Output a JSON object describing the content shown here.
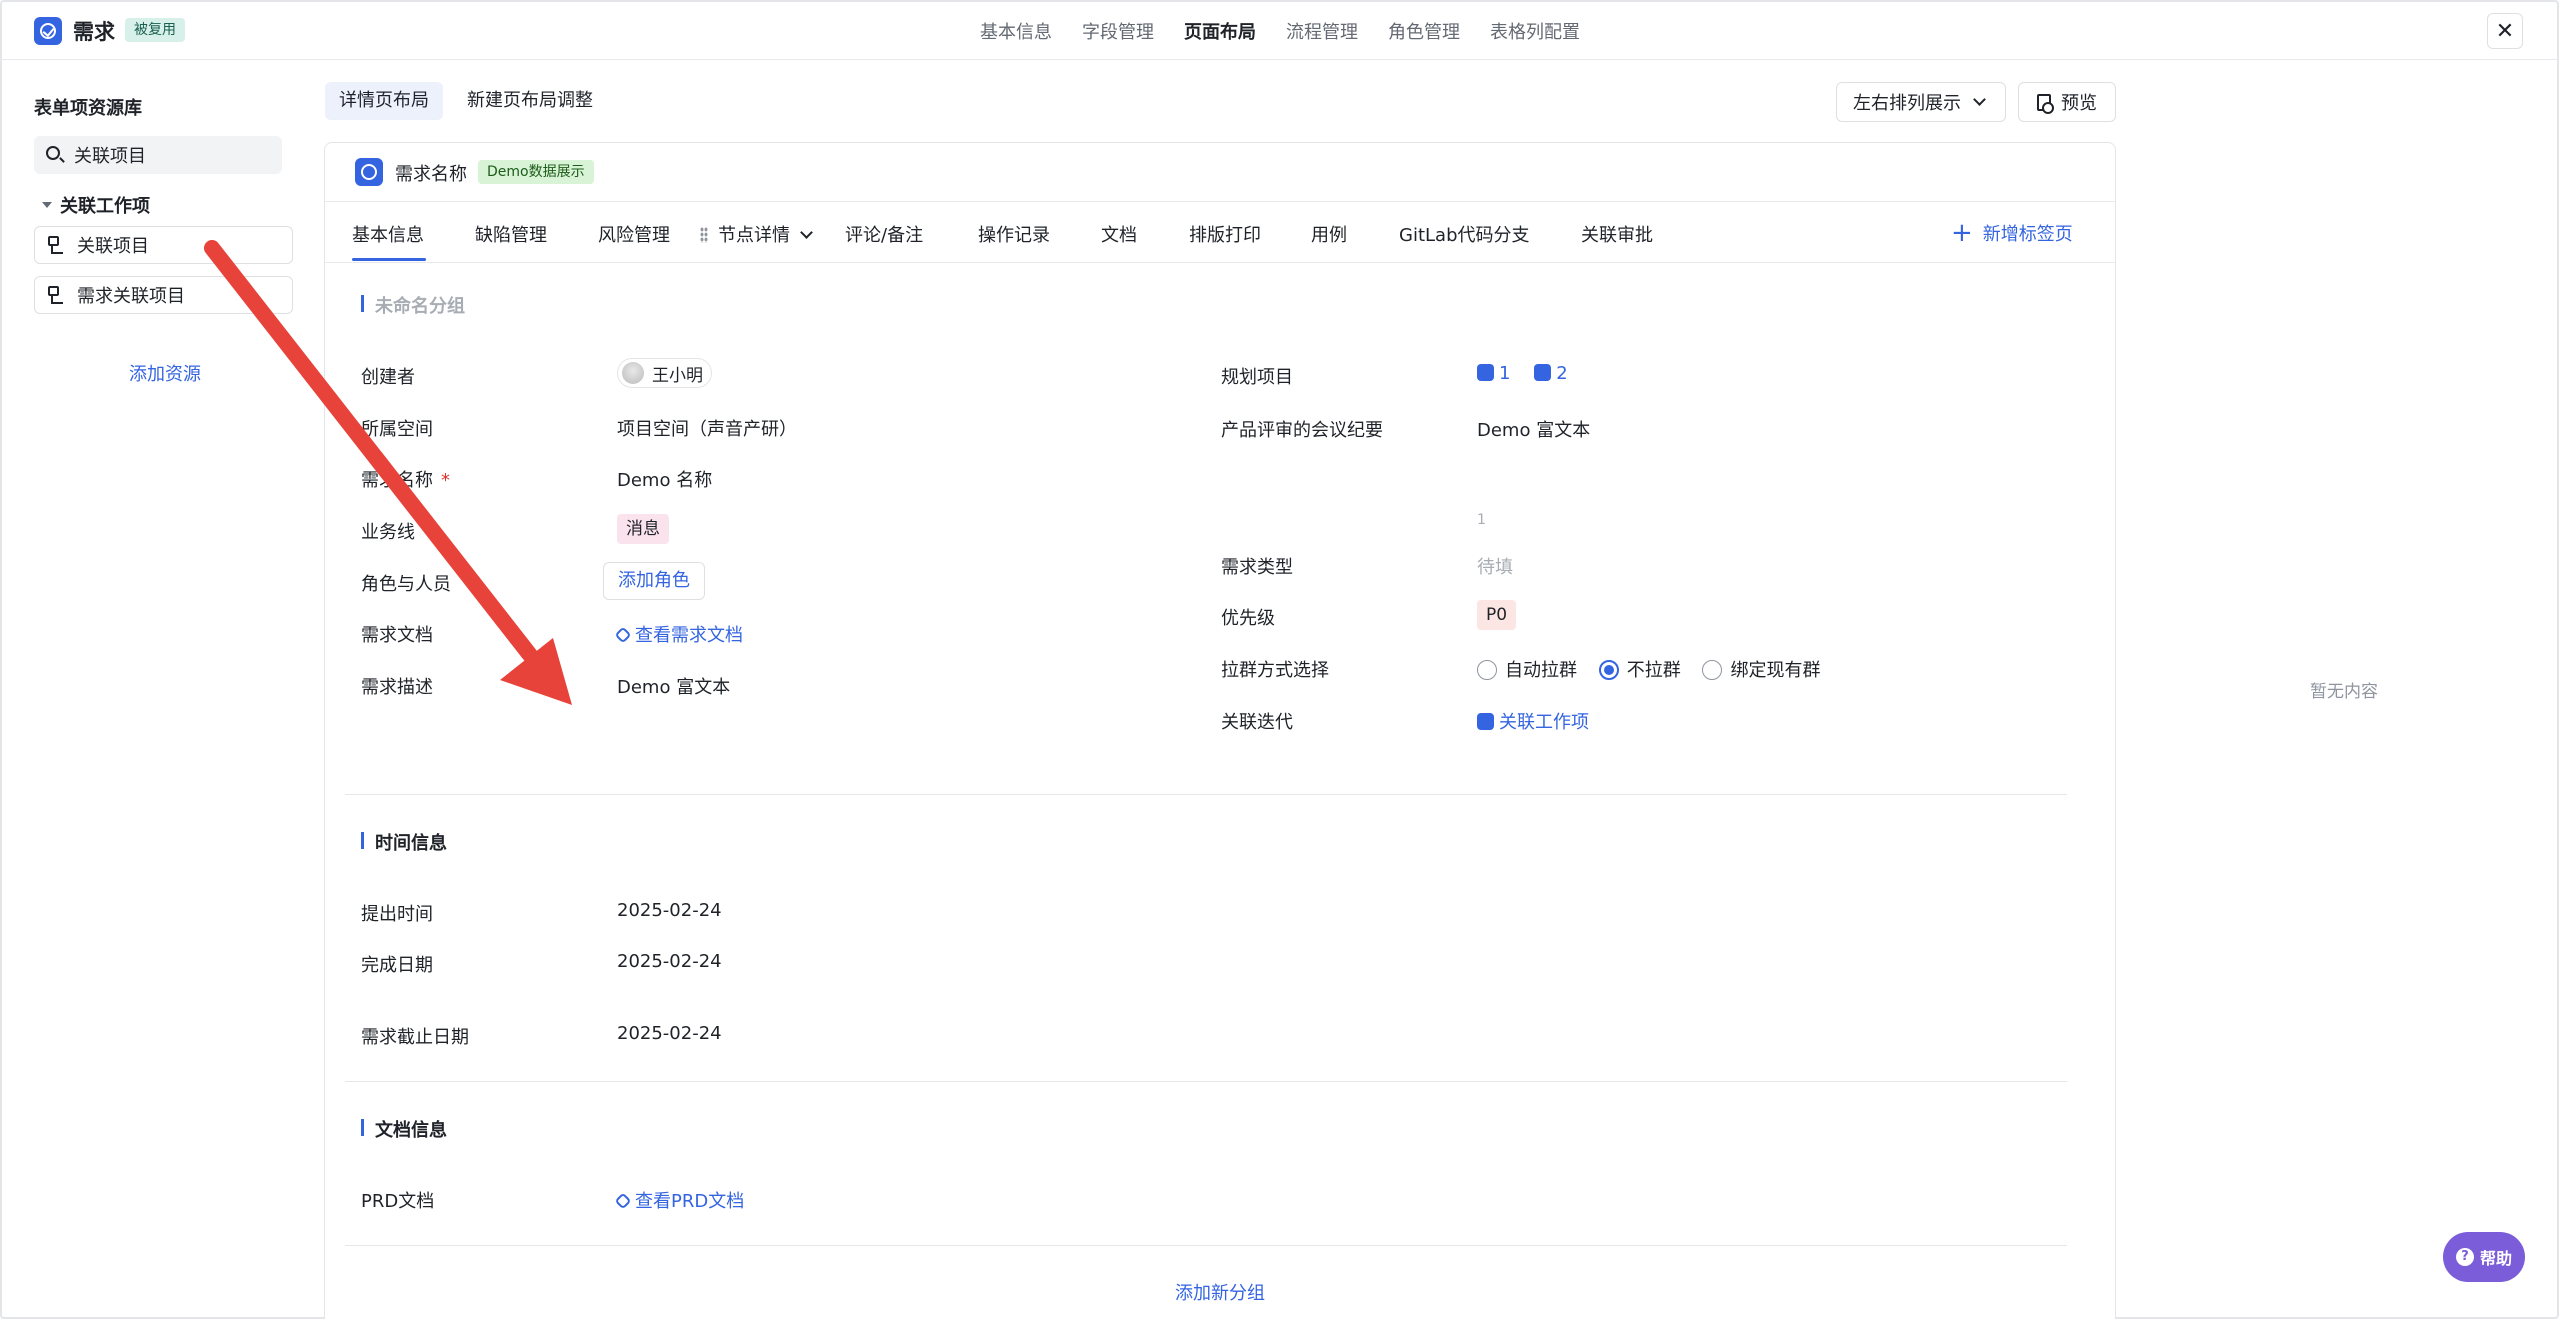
{
  "app": {
    "title": "需求",
    "badge": "被复用",
    "close_icon": "close-icon"
  },
  "top_nav": [
    "基本信息",
    "字段管理",
    "页面布局",
    "流程管理",
    "角色管理",
    "表格列配置"
  ],
  "top_nav_active": "页面布局",
  "resource_panel": {
    "title": "表单项资源库",
    "search_value": "关联项目",
    "group": "关联工作项",
    "items": [
      "关联项目",
      "需求关联项目"
    ],
    "add_label": "添加资源"
  },
  "layout_tabs": [
    "详情页布局",
    "新建页布局调整"
  ],
  "layout_tabs_active": "详情页布局",
  "sort_select": "左右排列展示",
  "preview_label": "预览",
  "card": {
    "title": "需求名称",
    "badge": "Demo数据展示",
    "tabs": [
      "基本信息",
      "缺陷管理",
      "风险管理",
      "节点详情",
      "评论/备注",
      "操作记录",
      "文档",
      "排版打印",
      "用例",
      "GitLab代码分支",
      "关联审批"
    ],
    "active_tab": "基本信息",
    "add_tab_label": "新增标签页"
  },
  "section_unnamed": {
    "title": "未命名分组",
    "left": {
      "creator_label": "创建者",
      "creator_value": "王小明",
      "space_label": "所属空间",
      "space_value": "项目空间（声音产研）",
      "name_label": "需求名称",
      "required_mark": "*",
      "name_value": "Demo 名称",
      "biz_label": "业务线",
      "biz_value": "消息",
      "role_label": "角色与人员",
      "role_button": "添加角色",
      "doc_label": "需求文档",
      "doc_link": "查看需求文档",
      "desc_label": "需求描述",
      "desc_value": "Demo 富文本"
    },
    "right": {
      "plan_label": "规划项目",
      "plan_values": [
        "1",
        "2"
      ],
      "meeting_label": "产品评审的会议纪要",
      "meeting_value": "Demo 富文本",
      "counter": "1",
      "type_label": "需求类型",
      "type_placeholder": "待填",
      "priority_label": "优先级",
      "priority_value": "P0",
      "group_label": "拉群方式选择",
      "group_options": [
        "自动拉群",
        "不拉群",
        "绑定现有群"
      ],
      "group_selected": "不拉群",
      "iter_label": "关联迭代",
      "iter_value": "关联工作项"
    }
  },
  "section_time": {
    "title": "时间信息",
    "submit_label": "提出时间",
    "submit_value": "2025-02-24",
    "done_label": "完成日期",
    "done_value": "2025-02-24",
    "deadline_label": "需求截止日期",
    "deadline_value": "2025-02-24"
  },
  "section_doc": {
    "title": "文档信息",
    "prd_label": "PRD文档",
    "prd_link": "查看PRD文档"
  },
  "add_group_label": "添加新分组",
  "empty_text": "暂无内容",
  "help_label": "帮助",
  "colors": {
    "accent": "#3464e0",
    "arrow": "#e8433a",
    "help": "#7b5cd9"
  }
}
